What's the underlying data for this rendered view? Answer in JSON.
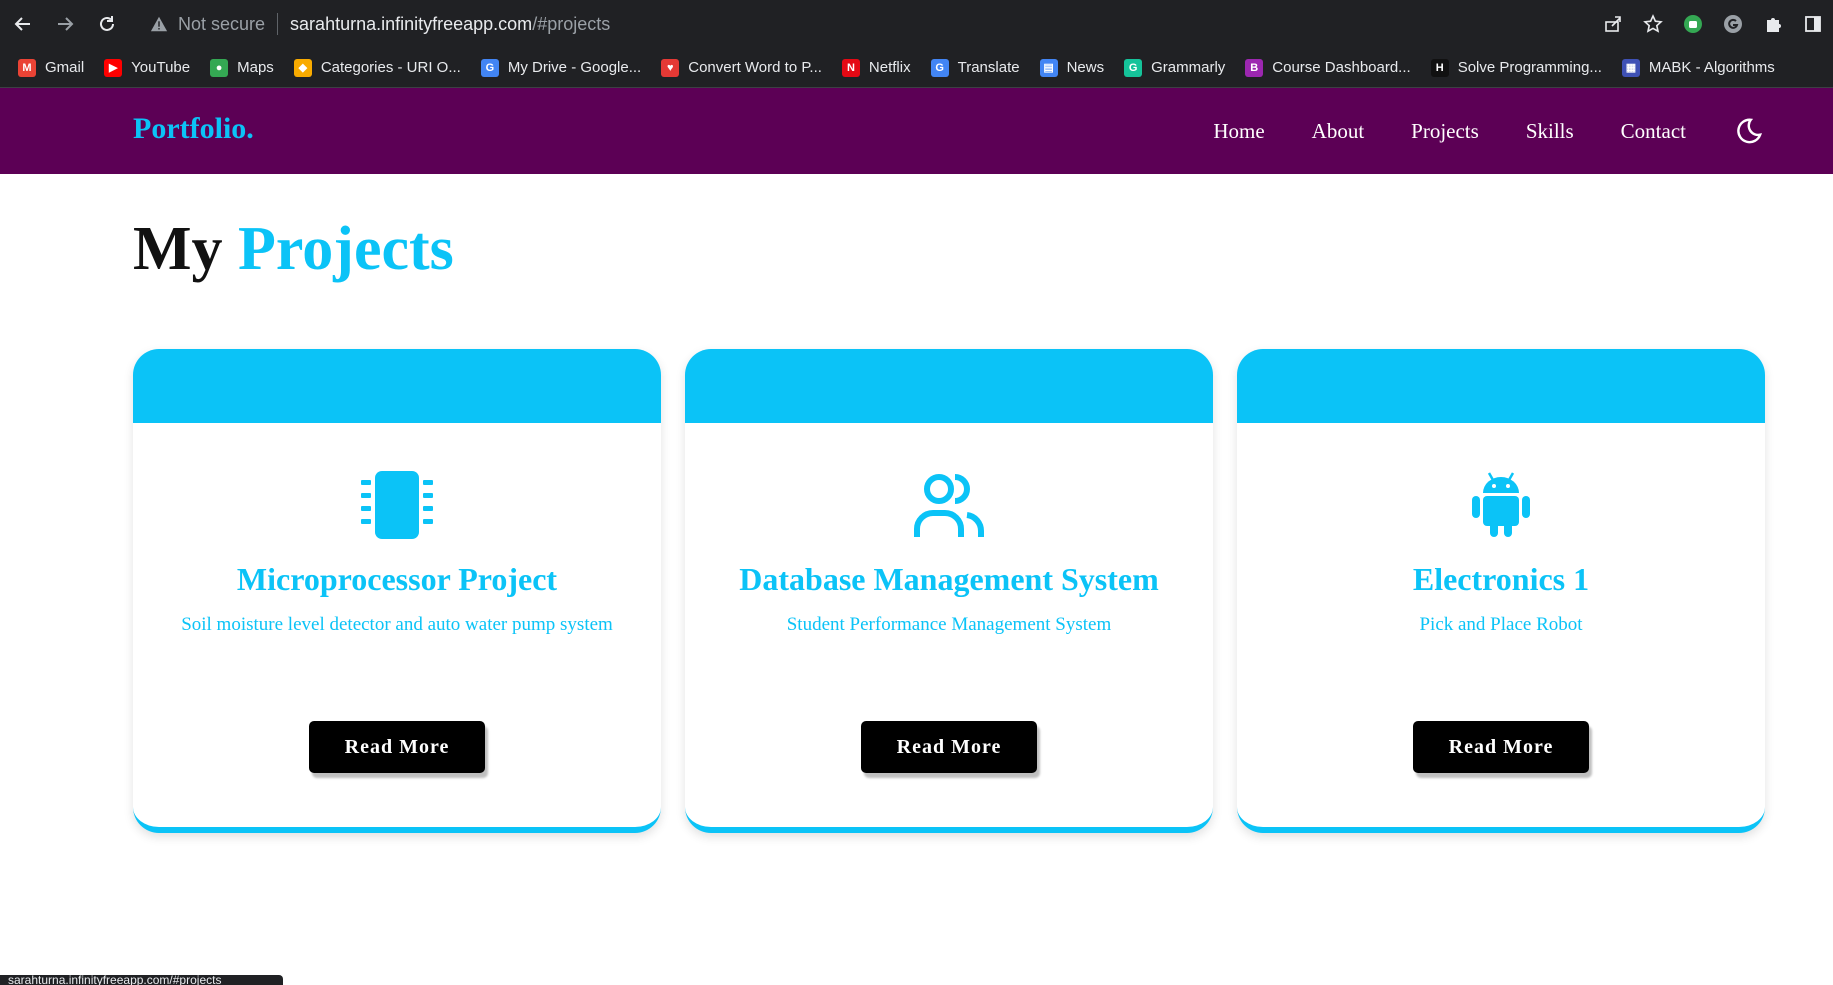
{
  "browser": {
    "security_label": "Not secure",
    "url_host": "sarahturna.infinityfreeapp.com",
    "url_path": "/#projects",
    "status_url": "sarahturna.infinityfreeapp.com/#projects"
  },
  "bookmarks": [
    {
      "label": "Gmail",
      "icon": "gmail-icon",
      "color": "#ea4335",
      "glyph": "M"
    },
    {
      "label": "YouTube",
      "icon": "youtube-icon",
      "color": "#ff0000",
      "glyph": "▶"
    },
    {
      "label": "Maps",
      "icon": "maps-icon",
      "color": "#34a853",
      "glyph": "●"
    },
    {
      "label": "Categories - URI O...",
      "icon": "uri-icon",
      "color": "#f9ab00",
      "glyph": "◆"
    },
    {
      "label": "My Drive - Google...",
      "icon": "google-icon",
      "color": "#4285f4",
      "glyph": "G"
    },
    {
      "label": "Convert Word to P...",
      "icon": "heart-icon",
      "color": "#e53935",
      "glyph": "♥"
    },
    {
      "label": "Netflix",
      "icon": "netflix-icon",
      "color": "#e50914",
      "glyph": "N"
    },
    {
      "label": "Translate",
      "icon": "translate-icon",
      "color": "#4285f4",
      "glyph": "G"
    },
    {
      "label": "News",
      "icon": "news-icon",
      "color": "#4285f4",
      "glyph": "▤"
    },
    {
      "label": "Grammarly",
      "icon": "grammarly-icon",
      "color": "#15c39a",
      "glyph": "G"
    },
    {
      "label": "Course Dashboard...",
      "icon": "blackboard-icon",
      "color": "#9c27b0",
      "glyph": "B"
    },
    {
      "label": "Solve Programming...",
      "icon": "hackerrank-icon",
      "color": "#111111",
      "glyph": "H"
    },
    {
      "label": "MABK - Algorithms",
      "icon": "mabk-icon",
      "color": "#3f51b5",
      "glyph": "▦"
    }
  ],
  "site": {
    "logo": "Portfolio.",
    "nav": [
      "Home",
      "About",
      "Projects",
      "Skills",
      "Contact"
    ],
    "accent_color": "#0bc3f7",
    "header_color": "#5c0055"
  },
  "section": {
    "title_plain": "My",
    "title_accent": "Projects"
  },
  "projects": [
    {
      "icon": "microchip-icon",
      "title": "Microprocessor Project",
      "description": "Soil moisture level detector and auto water pump system",
      "button": "Read More"
    },
    {
      "icon": "users-icon",
      "title": "Database Management System",
      "description": "Student Performance Management System",
      "button": "Read More"
    },
    {
      "icon": "android-icon",
      "title": "Electronics 1",
      "description": "Pick and Place Robot",
      "button": "Read More"
    }
  ]
}
